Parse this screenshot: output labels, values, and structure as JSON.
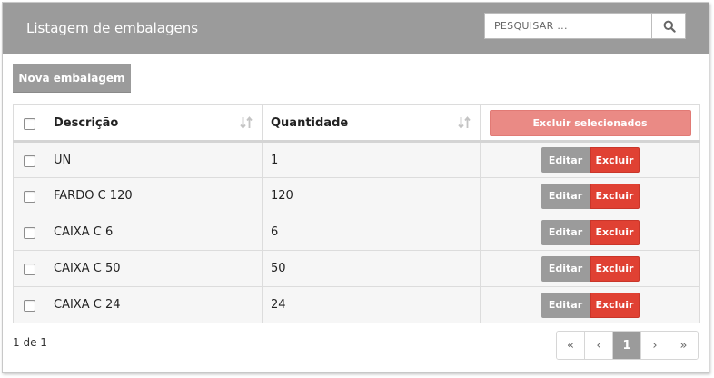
{
  "header": {
    "title": "Listagem de embalagens",
    "search_placeholder": "PESQUISAR ..."
  },
  "toolbar": {
    "new_label": "Nova embalagem"
  },
  "table": {
    "columns": [
      "Descrição",
      "Quantidade"
    ],
    "delete_selected_label": "Excluir selecionados",
    "edit_label": "Editar",
    "delete_label": "Excluir",
    "rows": [
      {
        "descricao": "UN",
        "quantidade": "1"
      },
      {
        "descricao": "FARDO C 120",
        "quantidade": "120"
      },
      {
        "descricao": "CAIXA C 6",
        "quantidade": "6"
      },
      {
        "descricao": "CAIXA C 50",
        "quantidade": "50"
      },
      {
        "descricao": "CAIXA C 24",
        "quantidade": "24"
      }
    ]
  },
  "pagination": {
    "info": "1 de 1",
    "first": "«",
    "prev": "‹",
    "current": "1",
    "next": "›",
    "last": "»"
  },
  "colors": {
    "header_bg": "#9b9b9b",
    "danger": "#e04133",
    "danger_light": "#ea8a85"
  },
  "icons": {
    "search": "search-icon",
    "sort": "sort-icon"
  }
}
